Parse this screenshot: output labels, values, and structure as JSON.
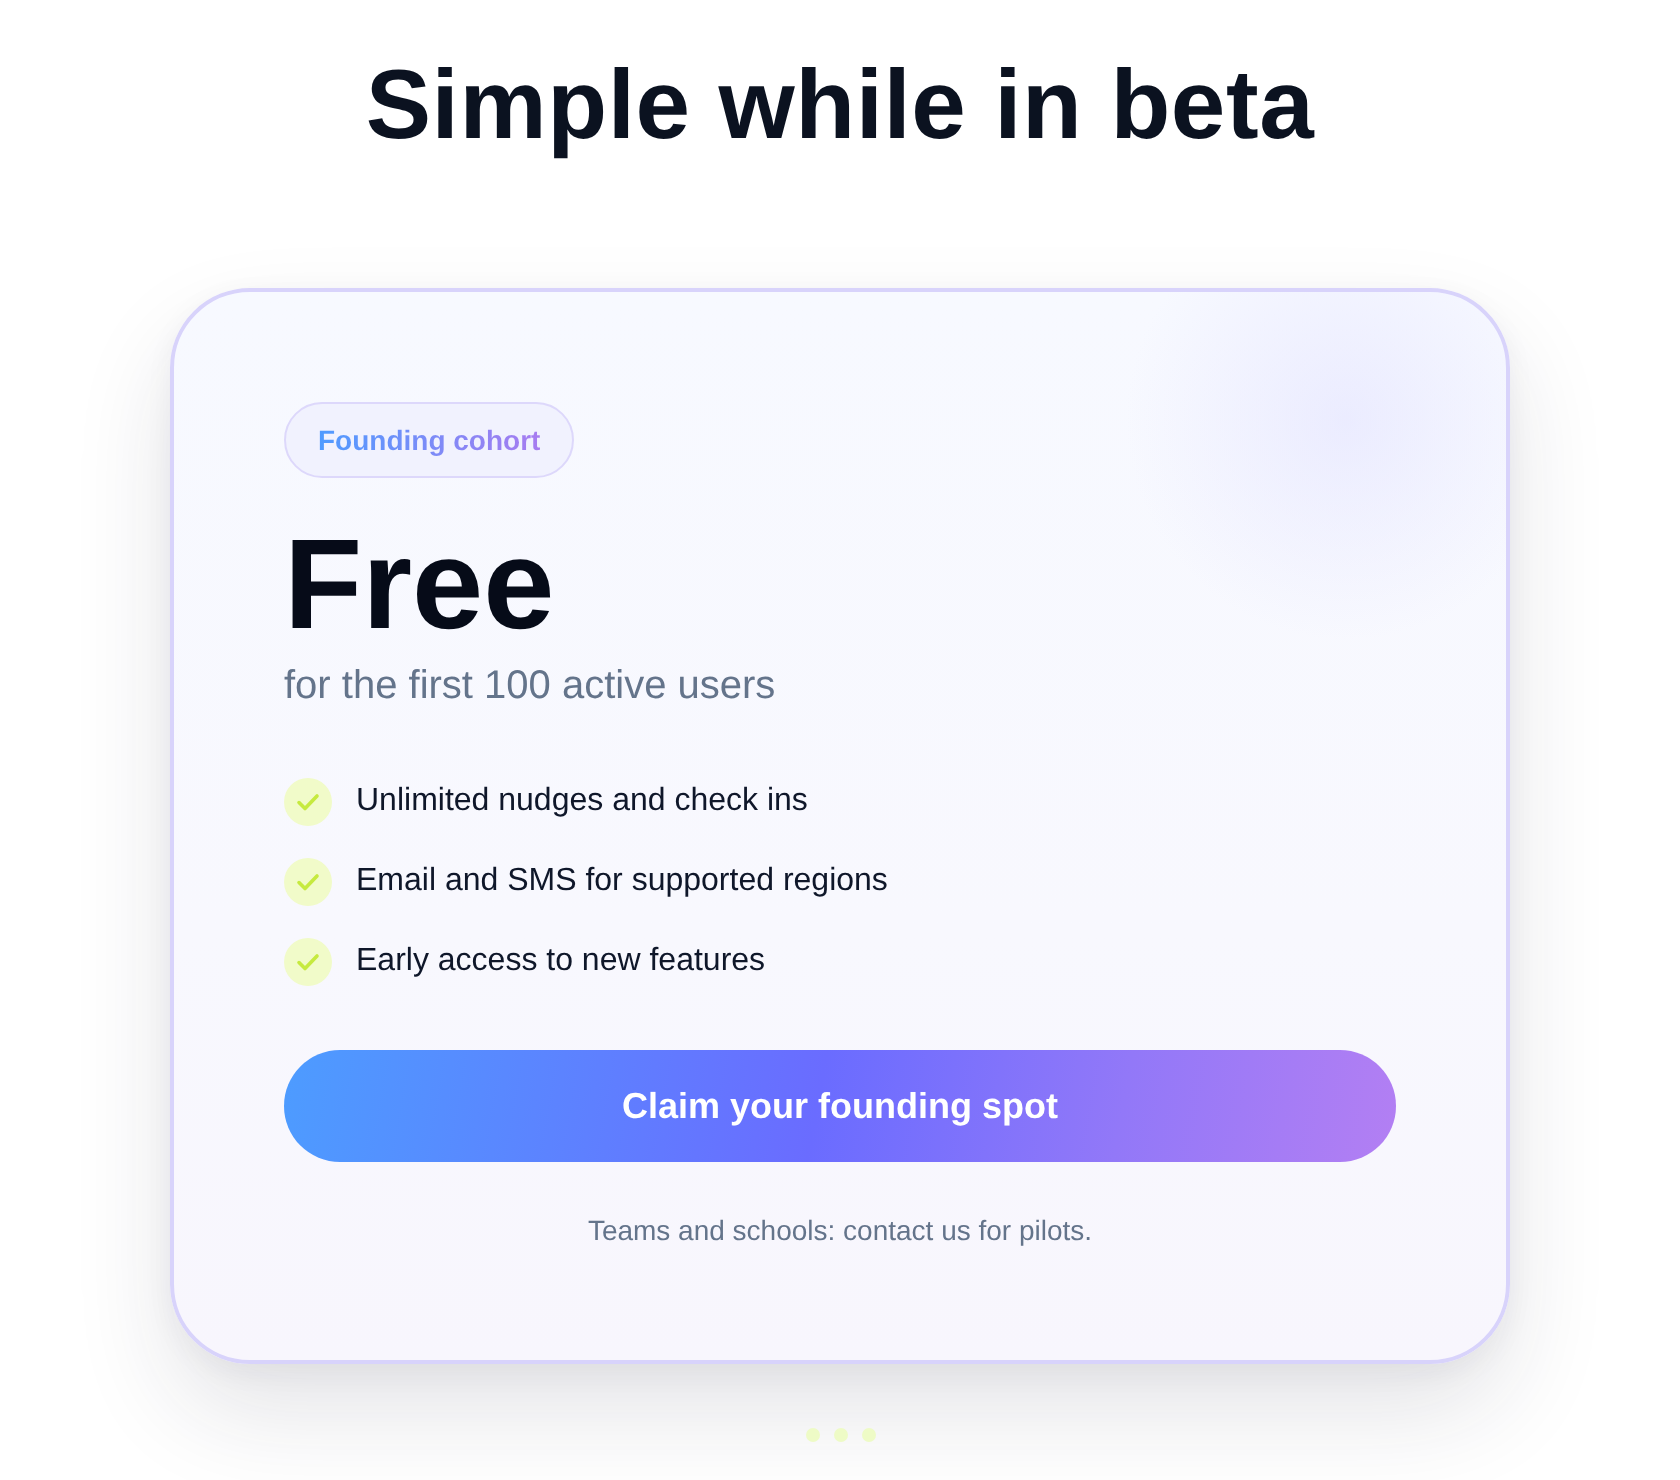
{
  "heading": "Simple while in beta",
  "card": {
    "badge": "Founding cohort",
    "price": "Free",
    "price_note": "for the first 100 active users",
    "features": [
      "Unlimited nudges and check ins",
      "Email and SMS for supported regions",
      "Early access to new features"
    ],
    "button": "Claim your founding spot",
    "footnote": "Teams and schools: contact us for pilots."
  }
}
